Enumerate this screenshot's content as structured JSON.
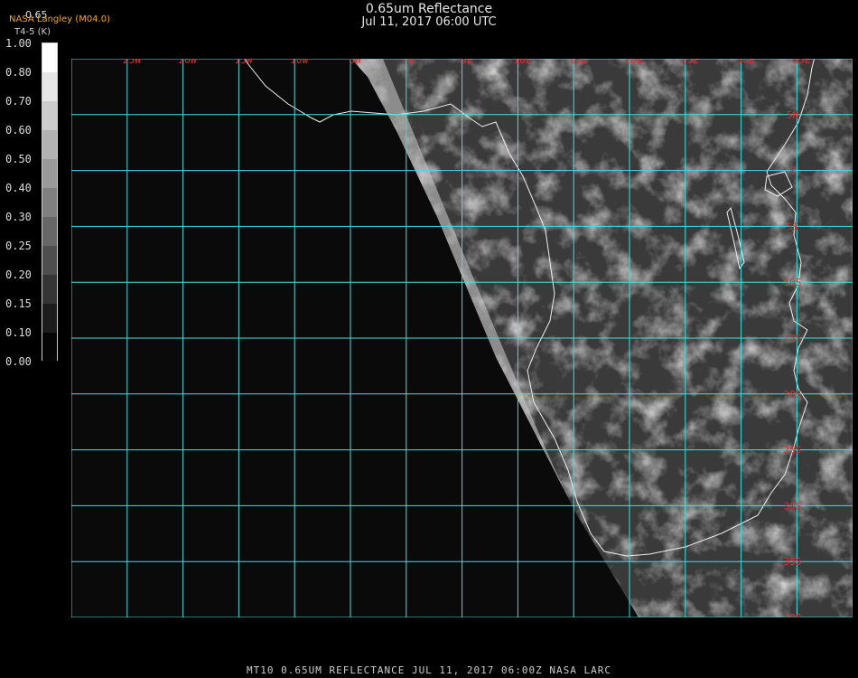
{
  "header": {
    "title": "0.65um Reflectance",
    "datetime": "Jul 11, 2017 06:00 UTC",
    "organization": "NASA Langley (M04.0)",
    "field": "T4-5 (K)",
    "colorbar_top_value": "0.65"
  },
  "colorbar": {
    "labels": [
      "1.00",
      "0.80",
      "0.70",
      "0.60",
      "0.50",
      "0.40",
      "0.30",
      "0.25",
      "0.20",
      "0.15",
      "0.10",
      "0.00"
    ]
  },
  "grid": {
    "longitudes": [
      "25W",
      "20W",
      "15W",
      "10W",
      "5W",
      "0",
      "5E",
      "10E",
      "15E",
      "20E",
      "25E",
      "30E",
      "35E"
    ],
    "latitudes": [
      "5N",
      "0",
      "5S",
      "10S",
      "15S",
      "20S",
      "25S",
      "30S",
      "35S",
      "40S"
    ]
  },
  "footer": {
    "text": "MT10  0.65UM REFLECTANCE   JUL 11, 2017 06:00Z   NASA LARC"
  },
  "colors": {
    "grid": "#40e0e0",
    "labels": "#e03030",
    "org": "#f0a830"
  }
}
